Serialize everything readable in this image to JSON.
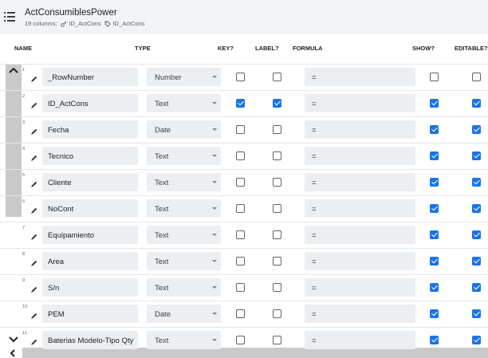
{
  "header": {
    "title": "ActConsumiblesPower",
    "columns_count": "19 columns:",
    "chip1": "ID_ActCons",
    "chip2": "ID_ActCons"
  },
  "columns": {
    "name": "NAME",
    "type": "TYPE",
    "key": "KEY?",
    "label": "LABEL?",
    "formula": "FORMULA",
    "show": "SHOW?",
    "editable": "EDITABLE?"
  },
  "rows": [
    {
      "num": "1",
      "name": "_RowNumber",
      "type": "Number",
      "key": false,
      "label": false,
      "formula": "=",
      "show": false,
      "editable": false
    },
    {
      "num": "2",
      "name": "ID_ActCons",
      "type": "Text",
      "key": true,
      "label": true,
      "formula": "=",
      "show": true,
      "editable": true
    },
    {
      "num": "3",
      "name": "Fecha",
      "type": "Date",
      "key": false,
      "label": false,
      "formula": "=",
      "show": true,
      "editable": true
    },
    {
      "num": "4",
      "name": "Tecnico",
      "type": "Text",
      "key": false,
      "label": false,
      "formula": "=",
      "show": true,
      "editable": true
    },
    {
      "num": "5",
      "name": "Cliente",
      "type": "Text",
      "key": false,
      "label": false,
      "formula": "=",
      "show": true,
      "editable": true
    },
    {
      "num": "6",
      "name": "NoCont",
      "type": "Text",
      "key": false,
      "label": false,
      "formula": "=",
      "show": true,
      "editable": true
    },
    {
      "num": "7",
      "name": "Equipamiento",
      "type": "Text",
      "key": false,
      "label": false,
      "formula": "=",
      "show": true,
      "editable": true
    },
    {
      "num": "8",
      "name": "Area",
      "type": "Text",
      "key": false,
      "label": false,
      "formula": "=",
      "show": true,
      "editable": true
    },
    {
      "num": "9",
      "name": "S/n",
      "type": "Text",
      "key": false,
      "label": false,
      "formula": "=",
      "show": true,
      "editable": true
    },
    {
      "num": "10",
      "name": "PEM",
      "type": "Date",
      "key": false,
      "label": false,
      "formula": "=",
      "show": true,
      "editable": true
    },
    {
      "num": "11",
      "name": "Baterias Modelo-Tipo Qty",
      "type": "Text",
      "key": false,
      "label": false,
      "formula": "=",
      "show": true,
      "editable": true
    }
  ],
  "colors": {
    "accent": "#1a73e8",
    "field_bg": "#eceff1",
    "header_bg": "#f1f3f4"
  }
}
